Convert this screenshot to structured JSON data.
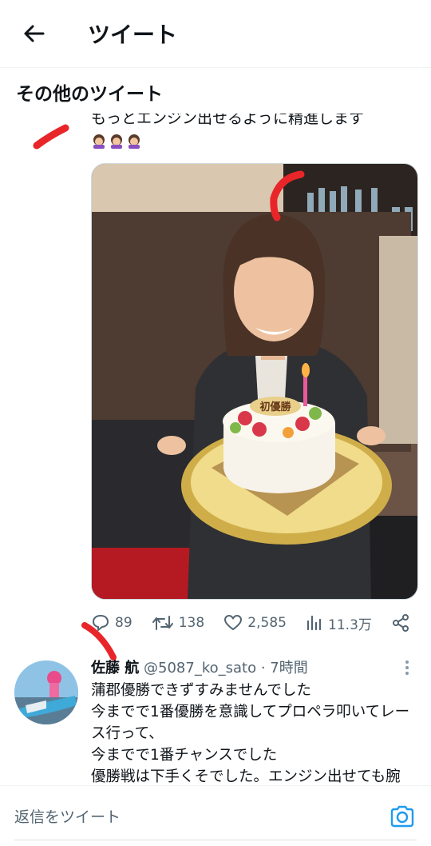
{
  "header": {
    "title": "ツイート",
    "back_icon": "arrow-left-icon"
  },
  "section": {
    "title": "その他のツイート"
  },
  "tweet1": {
    "text_partial": "もっとエンジン出せるように精進します",
    "emojis": [
      "woman-bowing-icon",
      "woman-bowing-icon",
      "woman-bowing-icon"
    ],
    "photo_cake_text": "初優勝",
    "stats": {
      "replies": "89",
      "retweets": "138",
      "likes": "2,585",
      "views": "11.3万"
    }
  },
  "tweet2": {
    "name": "佐藤 航",
    "handle_time": "@5087_ko_sato · 7時間",
    "lines": [
      "蒲郡優勝できずすみませんでした",
      "今までで1番優勝を意識してプロペラ叩いてレー",
      "ス行って、",
      "今までで1番チャンスでした",
      "優勝戦は下手くそでした。エンジン出せても腕"
    ]
  },
  "reply": {
    "placeholder": "返信をツイート",
    "camera_icon": "camera-icon"
  },
  "colors": {
    "text": "#0f1419",
    "muted": "#536471",
    "accent": "#1d9bf0",
    "annotation": "#e8262a"
  }
}
